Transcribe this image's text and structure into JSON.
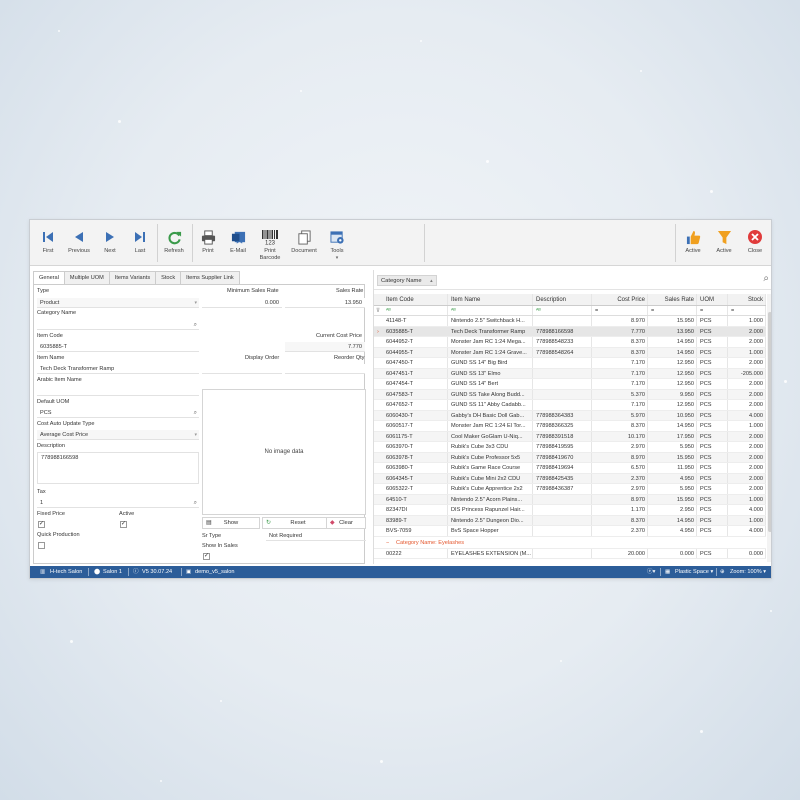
{
  "ribbon": {
    "first": "First",
    "previous": "Previous",
    "next": "Next",
    "last": "Last",
    "refresh": "Refresh",
    "print": "Print",
    "email": "E-Mail",
    "print_barcode": "Print\nBarcode",
    "document": "Document",
    "tools": "Tools",
    "active_1": "Active",
    "active_2": "Active",
    "close": "Close",
    "barcode_digits": "123"
  },
  "tabs": [
    "General",
    "Multiple UOM",
    "Items Variants",
    "Stock",
    "Items Supplier Link"
  ],
  "form": {
    "type_label": "Type",
    "type_value": "Product",
    "min_sales_rate_label": "Minimum Sales Rate",
    "min_sales_rate_value": "0.000",
    "sales_rate_label": "Sales Rate",
    "sales_rate_value": "13.950",
    "category_name_label": "Category Name",
    "category_name_value": "",
    "item_code_label": "Item Code",
    "item_code_value": "6035885-T",
    "current_cost_price_label": "Current Cost Price",
    "current_cost_price_value": "7.770",
    "item_name_label": "Item Name",
    "item_name_value": "Tech Deck Transformer Ramp",
    "display_order_label": "Display Order",
    "reorder_qty_label": "Reorder Qty",
    "arabic_item_name_label": "Arabic Item Name",
    "default_uom_label": "Default UOM",
    "default_uom_value": "PCS",
    "cost_auto_update_type_label": "Cost Auto Update Type",
    "cost_auto_update_type_value": "Average Cost Price",
    "description_label": "Description",
    "description_value": "778988166598",
    "tax_label": "Tax",
    "tax_value": "1",
    "fixed_price_label": "Fixed Price",
    "active_label": "Active",
    "quick_production_label": "Quick Production",
    "sr_type_label": "Sr Type",
    "sr_type_value": "Not Required",
    "show_in_sales_label": "Show In Sales",
    "no_image_text": "No image data",
    "show_button": "Show",
    "reset_button": "Reset",
    "clear_button": "Clear",
    "check_mark": "✓"
  },
  "grid": {
    "group_chip": "Category Name",
    "columns": [
      "Item Code",
      "Item Name",
      "Description",
      "Cost Price",
      "Sales Rate",
      "UOM",
      "Stock"
    ],
    "filter_ops": [
      "=",
      "=",
      "=",
      "=",
      "="
    ],
    "rows": [
      [
        "41148-T",
        "Nintendo 2.5\" Switchback H...",
        "",
        "8.970",
        "15.950",
        "PCS",
        "1.000"
      ],
      [
        "6035885-T",
        "Tech Deck Transformer Ramp",
        "778988166598",
        "7.770",
        "13.950",
        "PCS",
        "2.000"
      ],
      [
        "6044952-T",
        "Monster Jam RC 1:24 Mega...",
        "778988548233",
        "8.370",
        "14.950",
        "PCS",
        "2.000"
      ],
      [
        "6044955-T",
        "Monster Jam RC 1:24 Grave...",
        "778988548264",
        "8.370",
        "14.950",
        "PCS",
        "1.000"
      ],
      [
        "6047450-T",
        "GUND SS 14\" Big Bird",
        "",
        "7.170",
        "12.950",
        "PCS",
        "2.000"
      ],
      [
        "6047451-T",
        "GUND SS 13\" Elmo",
        "",
        "7.170",
        "12.950",
        "PCS",
        "-205.000"
      ],
      [
        "6047454-T",
        "GUND SS 14\" Bert",
        "",
        "7.170",
        "12.950",
        "PCS",
        "2.000"
      ],
      [
        "6047583-T",
        "GUND SS Take Along Budd...",
        "",
        "5.370",
        "9.950",
        "PCS",
        "2.000"
      ],
      [
        "6047652-T",
        "GUND SS 11\" Abby Cadabb...",
        "",
        "7.170",
        "12.950",
        "PCS",
        "2.000"
      ],
      [
        "6060430-T",
        "Gabby's DH Basic Doll Gab...",
        "778988364383",
        "5.970",
        "10.950",
        "PCS",
        "4.000"
      ],
      [
        "6060517-T",
        "Monster Jam RC 1:24 El Tor...",
        "778988366325",
        "8.370",
        "14.950",
        "PCS",
        "1.000"
      ],
      [
        "6061175-T",
        "Cool Maker GoGlam U-Niq...",
        "778988391518",
        "10.170",
        "17.950",
        "PCS",
        "2.000"
      ],
      [
        "6063970-T",
        "Rubik's Cube 3x3 CDU",
        "778988419595",
        "2.970",
        "5.950",
        "PCS",
        "2.000"
      ],
      [
        "6063978-T",
        "Rubik's Cube Professor 5x5",
        "778988419670",
        "8.970",
        "15.950",
        "PCS",
        "2.000"
      ],
      [
        "6063980-T",
        "Rubik's Game Race Course",
        "778988419694",
        "6.570",
        "11.950",
        "PCS",
        "2.000"
      ],
      [
        "6064345-T",
        "Rubik's Cube Mini 2x2 CDU",
        "778988425435",
        "2.370",
        "4.950",
        "PCS",
        "2.000"
      ],
      [
        "6065322-T",
        "Rubik's Cube Apprentice 2x2",
        "778988436387",
        "2.970",
        "5.950",
        "PCS",
        "2.000"
      ],
      [
        "64510-T",
        "Nintendo 2.5\" Acorn Plains...",
        "",
        "8.970",
        "15.950",
        "PCS",
        "1.000"
      ],
      [
        "82347DI",
        "DIS Princess Rapunzel Hair...",
        "",
        "1.170",
        "2.950",
        "PCS",
        "4.000"
      ],
      [
        "83989-T",
        "Nintendo 2.5\" Dungeon Dio...",
        "",
        "8.370",
        "14.950",
        "PCS",
        "1.000"
      ],
      [
        "BVS-7059",
        "BvS Space Hopper",
        "",
        "2.370",
        "4.950",
        "PCS",
        "4.000"
      ]
    ],
    "group_row_label": "Category Name: Eyelashes",
    "last_row": [
      "00222",
      "EYELASHES EXTENSION (M...",
      "",
      "20.000",
      "0.000",
      "PCS",
      "0.000"
    ]
  },
  "status": {
    "app": "H-tech Salon",
    "branch": "Salon 1",
    "version": "V5 30.07.24",
    "db": "demo_v5_salon",
    "theme": "Plastic Space",
    "zoom": "Zoom: 100%"
  },
  "colors": {
    "ribbon_blue": "#3c70b5",
    "refresh_green": "#3a9a4a",
    "filter_orange": "#f0a020",
    "close_red": "#e03b3b",
    "status_blue": "#2c5d99",
    "group_text": "#e4572e"
  }
}
